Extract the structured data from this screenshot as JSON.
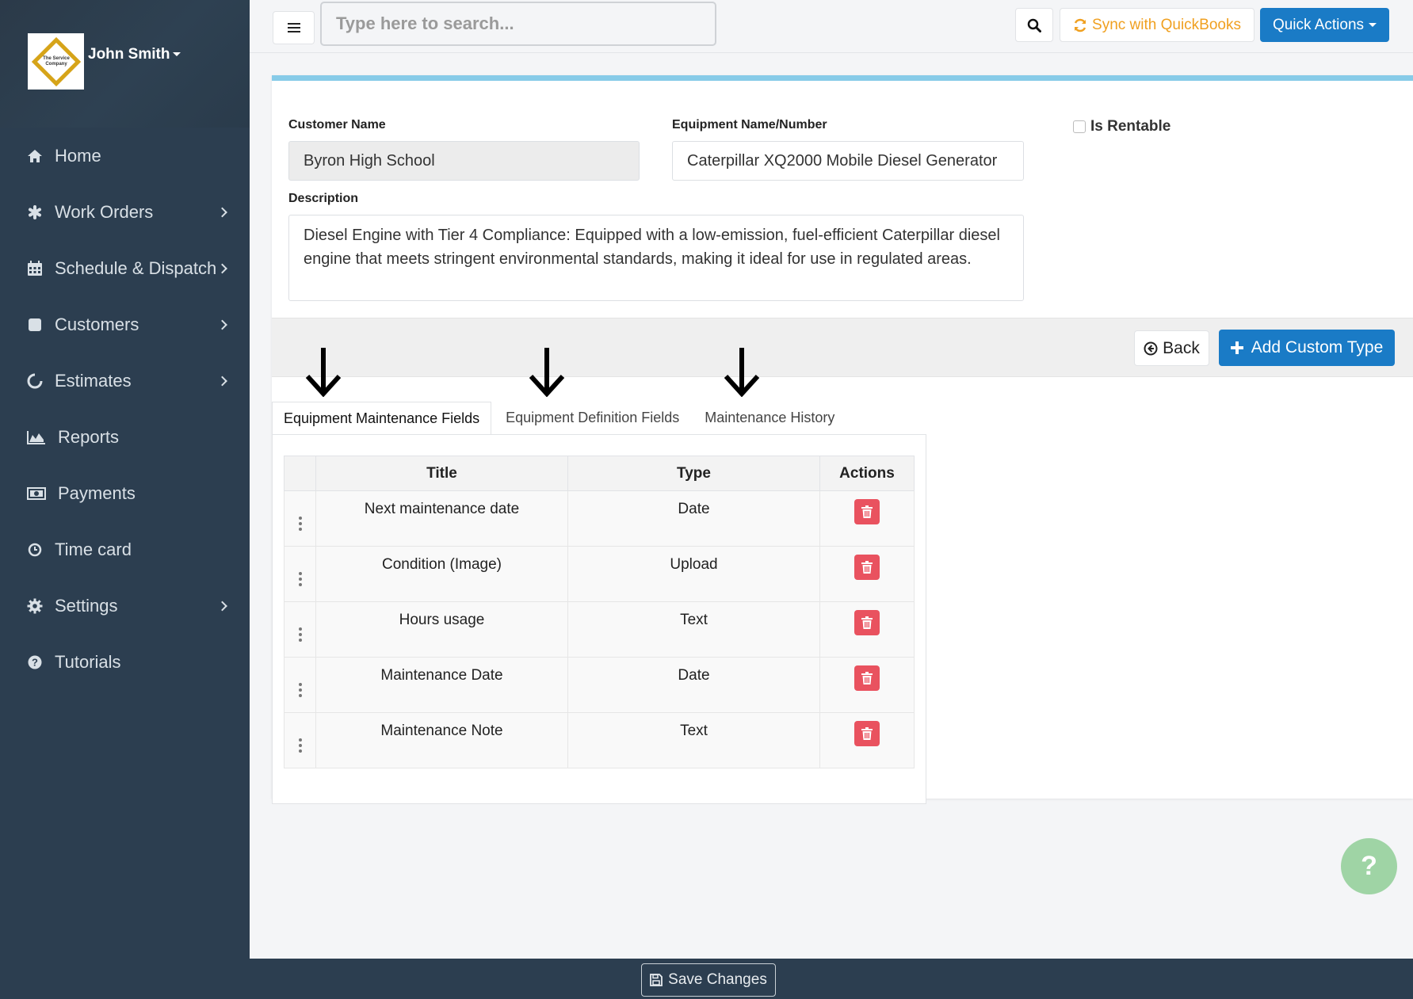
{
  "sidebar": {
    "logo_text": "The Service Company",
    "user_name": "John Smith",
    "items": [
      {
        "label": "Home",
        "icon": "home-icon",
        "has_submenu": false
      },
      {
        "label": "Work Orders",
        "icon": "asterisk-icon",
        "has_submenu": true
      },
      {
        "label": "Schedule & Dispatch",
        "icon": "calendar-icon",
        "has_submenu": true
      },
      {
        "label": "Customers",
        "icon": "square-icon",
        "has_submenu": true
      },
      {
        "label": "Estimates",
        "icon": "circle-notch-icon",
        "has_submenu": true
      },
      {
        "label": "Reports",
        "icon": "area-chart-icon",
        "has_submenu": false
      },
      {
        "label": "Payments",
        "icon": "money-icon",
        "has_submenu": false
      },
      {
        "label": "Time card",
        "icon": "clock-icon",
        "has_submenu": false
      },
      {
        "label": "Settings",
        "icon": "gear-icon",
        "has_submenu": true
      },
      {
        "label": "Tutorials",
        "icon": "question-circle-icon",
        "has_submenu": false
      }
    ]
  },
  "topbar": {
    "search_placeholder": "Type here to search...",
    "sync_label": "Sync with QuickBooks",
    "quick_actions_label": "Quick Actions"
  },
  "form": {
    "customer_label": "Customer Name",
    "customer_value": "Byron High School",
    "equipment_label": "Equipment Name/Number",
    "equipment_value": "Caterpillar XQ2000 Mobile Diesel Generator",
    "rentable_label": "Is Rentable",
    "rentable_checked": false,
    "description_label": "Description",
    "description_value": "Diesel Engine with Tier 4 Compliance: Equipped with a low-emission, fuel-efficient Caterpillar diesel engine that meets stringent environmental standards, making it ideal for use in regulated areas."
  },
  "actions": {
    "back_label": "Back",
    "add_label": "Add Custom Type"
  },
  "tabs": [
    {
      "label": "Equipment Maintenance Fields",
      "active": true
    },
    {
      "label": "Equipment Definition Fields",
      "active": false
    },
    {
      "label": "Maintenance History",
      "active": false
    }
  ],
  "table": {
    "headers": {
      "title": "Title",
      "type": "Type",
      "actions": "Actions"
    },
    "rows": [
      {
        "title": "Next maintenance date",
        "type": "Date"
      },
      {
        "title": "Condition (Image)",
        "type": "Upload"
      },
      {
        "title": "Hours usage",
        "type": "Text"
      },
      {
        "title": "Maintenance Date",
        "type": "Date"
      },
      {
        "title": "Maintenance Note",
        "type": "Text"
      }
    ]
  },
  "footer": {
    "save_label": "Save Changes"
  },
  "help": {
    "label": "?"
  },
  "colors": {
    "sidebar_bg": "#2c3e50",
    "primary": "#1a7bc6",
    "sync": "#f0a020",
    "danger": "#e9525f",
    "accent_bar": "#87cbe8",
    "help_bubble": "#9fd4a5"
  }
}
